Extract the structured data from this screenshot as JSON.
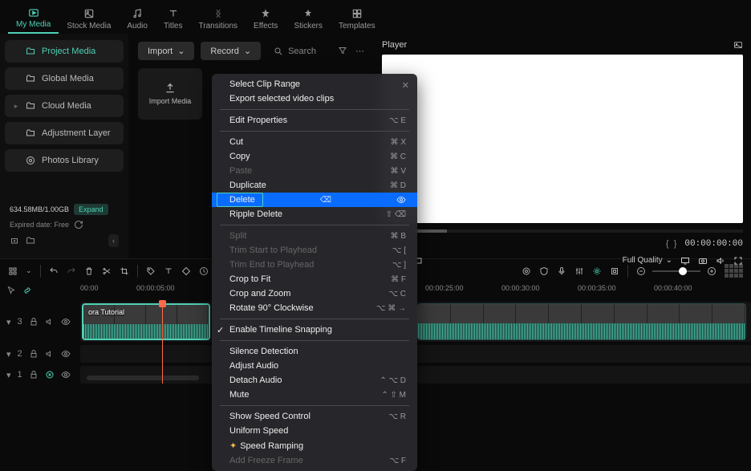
{
  "top_tabs": [
    {
      "label": "My Media",
      "active": true
    },
    {
      "label": "Stock Media"
    },
    {
      "label": "Audio"
    },
    {
      "label": "Titles"
    },
    {
      "label": "Transitions"
    },
    {
      "label": "Effects"
    },
    {
      "label": "Stickers"
    },
    {
      "label": "Templates"
    }
  ],
  "sidebar": {
    "items": [
      {
        "label": "Project Media",
        "active": true
      },
      {
        "label": "Global Media"
      },
      {
        "label": "Cloud Media",
        "expandable": true
      },
      {
        "label": "Adjustment Layer"
      },
      {
        "label": "Photos Library"
      }
    ],
    "storage": "634.58MB/1.00GB",
    "expand": "Expand",
    "expired": "Expired date: Free"
  },
  "media": {
    "import_btn": "Import",
    "record_btn": "Record",
    "search_placeholder": "Search",
    "import_tile": "Import Media"
  },
  "player": {
    "title": "Player",
    "timecode": "00:00:00:00",
    "quality": "Full Quality"
  },
  "timeline": {
    "ruler": [
      "00:00",
      "00:00:05:00",
      "",
      "",
      "",
      "00:00:25:00",
      "00:00:30:00",
      "00:00:35:00",
      "00:00:40:00",
      ""
    ],
    "tracks": [
      {
        "num": "3"
      },
      {
        "num": "2"
      },
      {
        "num": "1"
      }
    ],
    "clip_label": "ora Tutorial"
  },
  "context_menu": {
    "sections": [
      [
        {
          "label": "Select Clip Range"
        },
        {
          "label": "Export selected video clips"
        }
      ],
      [
        {
          "label": "Edit Properties",
          "shortcut": "⌥ E"
        }
      ],
      [
        {
          "label": "Cut",
          "shortcut": "⌘ X"
        },
        {
          "label": "Copy",
          "shortcut": "⌘ C"
        },
        {
          "label": "Paste",
          "shortcut": "⌘ V",
          "disabled": true
        },
        {
          "label": "Duplicate",
          "shortcut": "⌘ D"
        },
        {
          "label": "Delete",
          "shortcut": "⌫",
          "highlight": true,
          "boxed": true
        },
        {
          "label": "Ripple Delete",
          "shortcut": "⇧ ⌫"
        }
      ],
      [
        {
          "label": "Split",
          "shortcut": "⌘ B",
          "disabled": true
        },
        {
          "label": "Trim Start to Playhead",
          "shortcut": "⌥ [",
          "disabled": true
        },
        {
          "label": "Trim End to Playhead",
          "shortcut": "⌥ ]",
          "disabled": true
        },
        {
          "label": "Crop to Fit",
          "shortcut": "⌘ F"
        },
        {
          "label": "Crop and Zoom",
          "shortcut": "⌥ C"
        },
        {
          "label": "Rotate 90° Clockwise",
          "shortcut": "⌥ ⌘ →"
        }
      ],
      [
        {
          "label": "Enable Timeline Snapping",
          "checked": true
        }
      ],
      [
        {
          "label": "Silence Detection"
        },
        {
          "label": "Adjust Audio"
        },
        {
          "label": "Detach Audio",
          "shortcut": "⌃ ⌥ D"
        },
        {
          "label": "Mute",
          "shortcut": "⌃ ⇧ M"
        }
      ],
      [
        {
          "label": "Show Speed Control",
          "shortcut": "⌥ R"
        },
        {
          "label": "Uniform Speed"
        },
        {
          "label": "Speed Ramping",
          "star": true
        },
        {
          "label": "Add Freeze Frame",
          "shortcut": "⌥ F",
          "disabled": true
        }
      ]
    ]
  }
}
